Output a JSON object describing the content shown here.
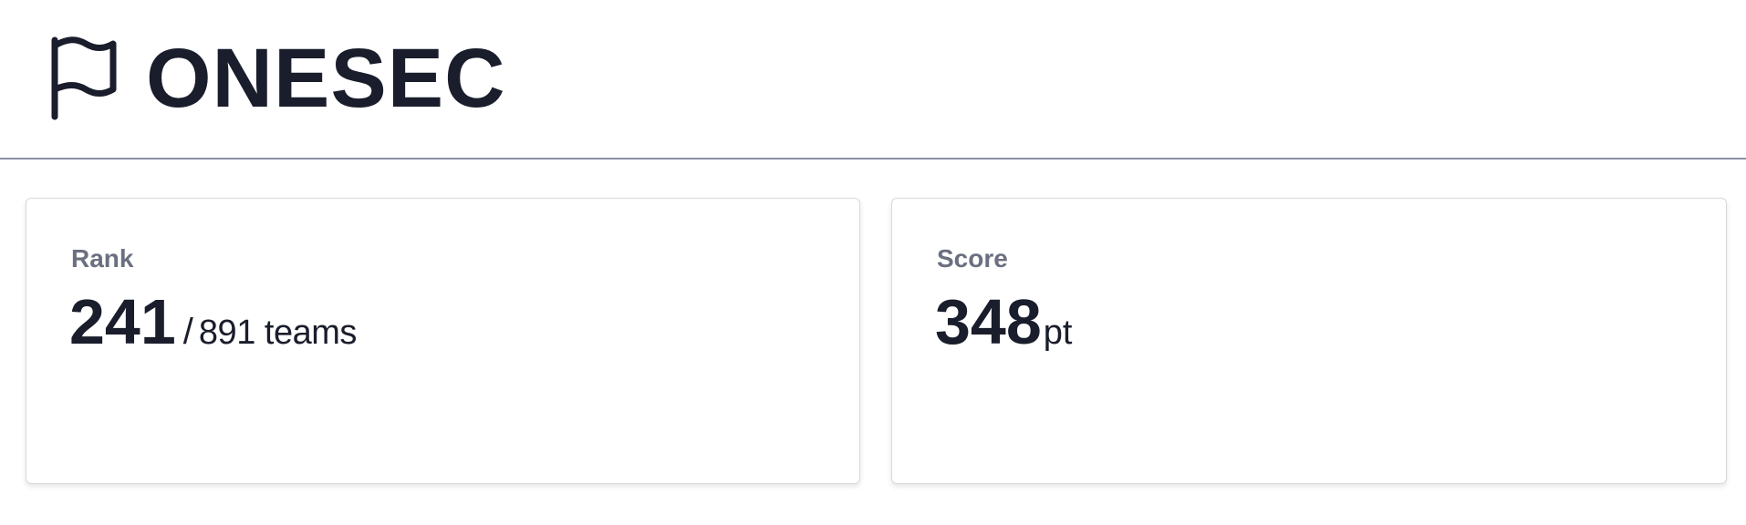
{
  "header": {
    "team_name": "ONESEC",
    "icon": "flag-icon"
  },
  "rank_card": {
    "label": "Rank",
    "value": "241",
    "separator": "/",
    "total": "891 teams"
  },
  "score_card": {
    "label": "Score",
    "value": "348",
    "unit": "pt"
  },
  "colors": {
    "text": "#1a1d2b",
    "label": "#6b6f7f",
    "divider": "#8a8ea3",
    "card_border": "#d8d9de"
  }
}
